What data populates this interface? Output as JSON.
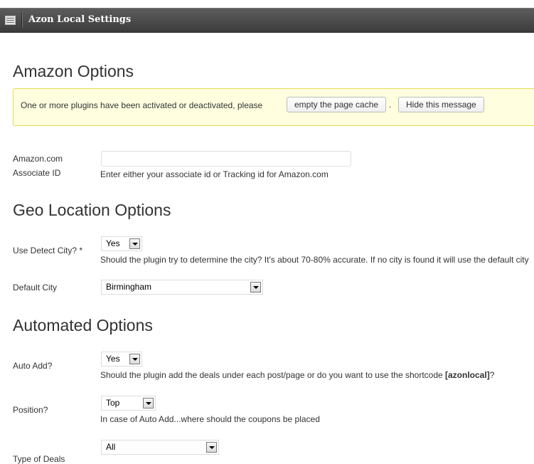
{
  "titlebar": {
    "title": "Azon Local Settings",
    "icon": "settings-page-icon"
  },
  "sections": {
    "amazon": {
      "heading": "Amazon Options"
    },
    "geo": {
      "heading": "Geo Location Options"
    },
    "automated": {
      "heading": "Automated Options"
    }
  },
  "notice": {
    "message": "One or more plugins have been activated or deactivated, please",
    "empty_cache_label": "empty the page cache",
    "separator": ".",
    "hide_label": "Hide this message"
  },
  "fields": {
    "associate_id": {
      "label_line1": "Amazon.com",
      "label_line2": "Associate ID",
      "value": "",
      "description": "Enter either your associate id or Tracking id for Amazon.com"
    },
    "detect_city": {
      "label": "Use Detect City? *",
      "value": "Yes",
      "description": "Should the plugin try to determine the city? It's about 70-80% accurate. If no city is found it will use the default city"
    },
    "default_city": {
      "label": "Default City",
      "value": "Birmingham"
    },
    "auto_add": {
      "label": "Auto Add?",
      "value": "Yes",
      "description_prefix": "Should the plugin add the deals under each post/page or do you want to use the shortcode ",
      "description_code": "[azonlocal]",
      "description_suffix": "?"
    },
    "position": {
      "label": "Position?",
      "value": "Top",
      "description": "In case of Auto Add...where should the coupons be placed"
    },
    "type": {
      "label": "Type of Deals",
      "value": "All"
    }
  }
}
